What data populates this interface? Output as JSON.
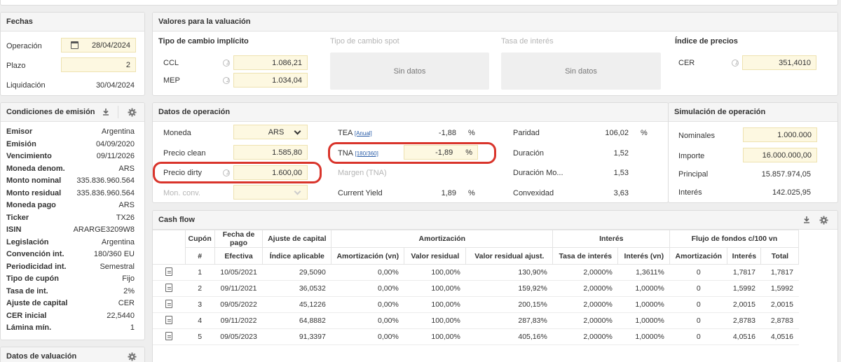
{
  "fechas": {
    "title": "Fechas",
    "operacion_label": "Operación",
    "operacion_value": "28/04/2024",
    "plazo_label": "Plazo",
    "plazo_value": "2",
    "liquidacion_label": "Liquidación",
    "liquidacion_value": "30/04/2024"
  },
  "condiciones": {
    "title": "Condiciones de emisión",
    "rows": [
      {
        "k": "Emisor",
        "v": "Argentina"
      },
      {
        "k": "Emisión",
        "v": "04/09/2020"
      },
      {
        "k": "Vencimiento",
        "v": "09/11/2026"
      },
      {
        "k": "Moneda denom.",
        "v": "ARS"
      },
      {
        "k": "Monto nominal",
        "v": "335.836.960.564"
      },
      {
        "k": "Monto residual",
        "v": "335.836.960.564"
      },
      {
        "k": "Moneda pago",
        "v": "ARS"
      },
      {
        "k": "Ticker",
        "v": "TX26"
      },
      {
        "k": "ISIN",
        "v": "ARARGE3209W8"
      },
      {
        "k": "Legislación",
        "v": "Argentina"
      },
      {
        "k": "Convención int.",
        "v": "180/360 EU"
      },
      {
        "k": "Periodicidad int.",
        "v": "Semestral"
      },
      {
        "k": "Tipo de cupón",
        "v": "Fijo"
      },
      {
        "k": "Tasa de int.",
        "v": "2%"
      },
      {
        "k": "Ajuste de capital",
        "v": "CER"
      },
      {
        "k": "CER inicial",
        "v": "22,5440"
      },
      {
        "k": "Lámina mín.",
        "v": "1"
      }
    ]
  },
  "datos_valuacion": {
    "title": "Datos de valuación"
  },
  "valores": {
    "title": "Valores para la valuación",
    "tc_implicito": "Tipo de cambio implícito",
    "ccl_label": "CCL",
    "ccl_value": "1.086,21",
    "mep_label": "MEP",
    "mep_value": "1.034,04",
    "tc_spot": "Tipo de cambio spot",
    "sin_datos_1": "Sin datos",
    "tasa_interes": "Tasa de interés",
    "sin_datos_2": "Sin datos",
    "indice_precios": "Índice de precios",
    "cer_label": "CER",
    "cer_value": "351,4010"
  },
  "operacion": {
    "title": "Datos de operación",
    "moneda_label": "Moneda",
    "moneda_value": "ARS",
    "precio_clean_label": "Precio clean",
    "precio_clean_value": "1.585,80",
    "precio_dirty_label": "Precio dirty",
    "precio_dirty_value": "1.600,00",
    "mon_conv_label": "Mon. conv.",
    "tea_label": "TEA",
    "tea_sup": "[Anual]",
    "tea_value": "-1,88",
    "tea_unit": "%",
    "tna_label": "TNA",
    "tna_sup": "[180/360]",
    "tna_value": "-1,89",
    "tna_unit": "%",
    "margen_label": "Margen (TNA)",
    "cy_label": "Current Yield",
    "cy_value": "1,89",
    "cy_unit": "%",
    "paridad_label": "Paridad",
    "paridad_value": "106,02",
    "paridad_unit": "%",
    "duracion_label": "Duración",
    "duracion_value": "1,52",
    "duracion_mod_label": "Duración Mo...",
    "duracion_mod_value": "1,53",
    "convexidad_label": "Convexidad",
    "convexidad_value": "3,63"
  },
  "simulacion": {
    "title": "Simulación de operación",
    "nominales_label": "Nominales",
    "nominales_value": "1.000.000",
    "importe_label": "Importe",
    "importe_value": "16.000.000,00",
    "principal_label": "Principal",
    "principal_value": "15.857.974,05",
    "interes_label": "Interés",
    "interes_value": "142.025,95"
  },
  "cashflow": {
    "title": "Cash flow",
    "group_headers": {
      "cupon": "Cupón",
      "fecha_pago": "Fecha de pago",
      "ajuste_capital": "Ajuste de capital",
      "amortizacion": "Amortización",
      "interes": "Interés",
      "flujo": "Flujo de fondos c/100 vn"
    },
    "sub_headers": [
      "#",
      "Efectiva",
      "Índice aplicable",
      "Amortización (vn)",
      "Valor residual",
      "Valor residual ajust.",
      "Tasa de interés",
      "Interés (vn)",
      "Amortización",
      "Interés",
      "Total"
    ],
    "rows": [
      [
        "1",
        "10/05/2021",
        "29,5090",
        "0,00%",
        "100,00%",
        "130,90%",
        "2,0000%",
        "1,3611%",
        "0",
        "1,7817",
        "1,7817"
      ],
      [
        "2",
        "09/11/2021",
        "36,0532",
        "0,00%",
        "100,00%",
        "159,92%",
        "2,0000%",
        "1,0000%",
        "0",
        "1,5992",
        "1,5992"
      ],
      [
        "3",
        "09/05/2022",
        "45,1226",
        "0,00%",
        "100,00%",
        "200,15%",
        "2,0000%",
        "1,0000%",
        "0",
        "2,0015",
        "2,0015"
      ],
      [
        "4",
        "09/11/2022",
        "64,8882",
        "0,00%",
        "100,00%",
        "287,83%",
        "2,0000%",
        "1,0000%",
        "0",
        "2,8783",
        "2,8783"
      ],
      [
        "5",
        "09/05/2023",
        "91,3397",
        "0,00%",
        "100,00%",
        "405,16%",
        "2,0000%",
        "1,0000%",
        "0",
        "4,0516",
        "4,0516"
      ]
    ]
  },
  "colors": {
    "highlight": "#d9342b",
    "input_bg": "#fdf8e1"
  }
}
